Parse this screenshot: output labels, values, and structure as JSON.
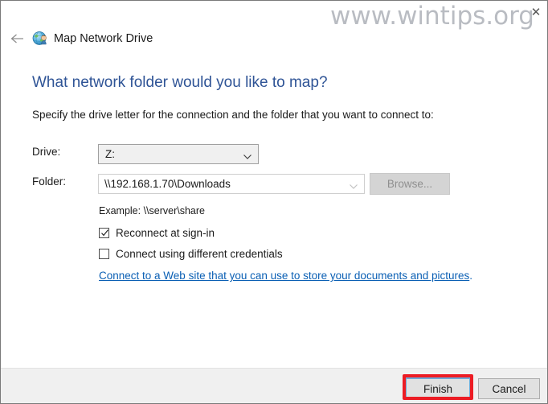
{
  "window": {
    "title": "Map Network Drive",
    "title_icon": "network-drive-globe-icon",
    "back_icon": "back-arrow-icon",
    "close_label": "✕"
  },
  "watermark": {
    "text": "www.wintips.org"
  },
  "content": {
    "heading": "What network folder would you like to map?",
    "subheading": "Specify the drive letter for the connection and the folder that you want to connect to:",
    "drive": {
      "label": "Drive:",
      "value": "Z:",
      "chevron_icon": "chevron-down-icon"
    },
    "folder": {
      "label": "Folder:",
      "value": "\\\\192.168.1.70\\Downloads",
      "placeholder": "",
      "chevron_icon": "chevron-down-icon"
    },
    "browse_button": {
      "label": "Browse...",
      "enabled": false
    },
    "example_text": "Example: \\\\server\\share",
    "checkboxes": [
      {
        "name": "reconnect-at-sign-in",
        "label": "Reconnect at sign-in",
        "checked": true
      },
      {
        "name": "connect-using-different-credentials",
        "label": "Connect using different credentials",
        "checked": false
      }
    ],
    "web_link": {
      "text": "Connect to a Web site that you can use to store your documents and pictures",
      "period": "."
    }
  },
  "footer": {
    "finish_label": "Finish",
    "cancel_label": "Cancel"
  },
  "annotation": {
    "highlight_color": "#ec1c24",
    "target": "finish-button"
  },
  "colors": {
    "heading_blue": "#2f5496",
    "link_blue": "#0a5fb4",
    "footer_bg": "#f0f0f0",
    "focus_border": "#6fa8d6"
  }
}
